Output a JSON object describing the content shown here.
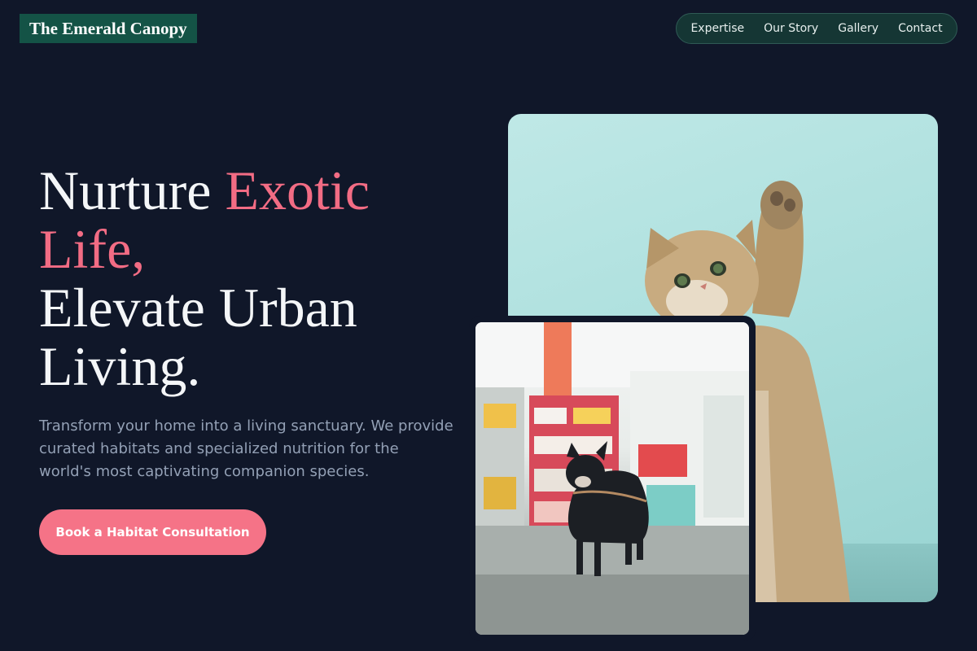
{
  "header": {
    "logo": "The Emerald Canopy",
    "nav": [
      {
        "label": "Expertise"
      },
      {
        "label": "Our Story"
      },
      {
        "label": "Gallery"
      },
      {
        "label": "Contact"
      }
    ]
  },
  "hero": {
    "headline_part1": "Nurture ",
    "headline_accent": "Exotic Life,",
    "headline_part2": "Elevate Urban Living.",
    "subtext": "Transform your home into a living sanctuary. We provide curated habitats and specialized nutrition for the world's most captivating companion species.",
    "cta_label": "Book a Habitat Consultation"
  },
  "theme": {
    "background": "#101729",
    "accent": "#f26c84",
    "brand_green": "#145346",
    "cta": "#f57387"
  }
}
